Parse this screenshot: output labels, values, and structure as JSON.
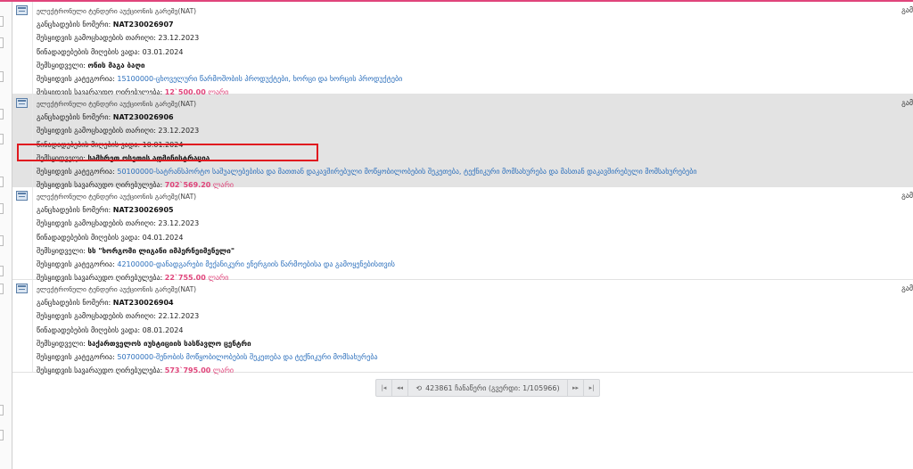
{
  "colors": {
    "accent": "#e0457b",
    "link": "#2a6ebb",
    "highlight_box": "#e0191f",
    "selected_row": "#e3e3e3"
  },
  "records": [
    {
      "type": "ელექტრონული ტენდერი აუქციონის გარეშე(NAT)",
      "number_label": "განცხადების ნომერი:",
      "number": "NAT230026907",
      "published_label": "შესყიდვის გამოცხადების თარიღი:",
      "published": "23.12.2023",
      "deadline_label": "წინადადებების მიღების ვადა:",
      "deadline": "03.01.2024",
      "buyer_label": "შემსყიდველი:",
      "buyer": "ონის მაგა ბაღი",
      "category_label": "შესყიდვის კატეგორია:",
      "category": "15100000-ცხოველური წარმოშობის პროდუქტები, ხორცი და ხორცის პროდუქტები",
      "value_label": "შესყიდვის სავარაუდო ღირებულება:",
      "value": "12`500.00",
      "currency": "ლარი",
      "edge": "გამ"
    },
    {
      "type": "ელექტრონული ტენდერი აუქციონის გარეშე(NAT)",
      "number_label": "განცხადების ნომერი:",
      "number": "NAT230026906",
      "published_label": "შესყიდვის გამოცხადების თარიღი:",
      "published": "23.12.2023",
      "deadline_label": "წინადადებების მიღების ვადა:",
      "deadline": "10.01.2024",
      "buyer_label": "შემსყიდველი:",
      "buyer": "სამხრეთ ოსეთის ადმინისტრაცია",
      "category_label": "შესყიდვის კატეგორია:",
      "category": "50100000-სატრანსპორტო საშუალებებისა და მათთან დაკავშირებული მოწყობილობების შეკეთება, ტექნიკური მომსახურება და მასთან დაკავშირებული მომსახურებები",
      "value_label": "შესყიდვის სავარაუდო ღირებულება:",
      "value": "702`569.20",
      "currency": "ლარი",
      "edge": "გამ"
    },
    {
      "type": "ელექტრონული ტენდერი აუქციონის გარეშე(NAT)",
      "number_label": "განცხადების ნომერი:",
      "number": "NAT230026905",
      "published_label": "შესყიდვის გამოცხადების თარიღი:",
      "published": "23.12.2023",
      "deadline_label": "წინადადებების მიღების ვადა:",
      "deadline": "04.01.2024",
      "buyer_label": "შემსყიდველი:",
      "buyer": "სს \"ხორგომი ლიგანი იმპერნეიმენელი\"",
      "category_label": "შესყიდვის კატეგორია:",
      "category": "42100000-დანადგარები მექანიკური ენერგიის წარმოებისა და გამოყენებისთვის",
      "value_label": "შესყიდვის სავარაუდო ღირებულება:",
      "value": "22`755.00",
      "currency": "ლარი",
      "edge": "გამ"
    },
    {
      "type": "ელექტრონული ტენდერი აუქციონის გარეშე(NAT)",
      "number_label": "განცხადების ნომერი:",
      "number": "NAT230026904",
      "published_label": "შესყიდვის გამოცხადების თარიღი:",
      "published": "22.12.2023",
      "deadline_label": "წინადადებების მიღების ვადა:",
      "deadline": "08.01.2024",
      "buyer_label": "შემსყიდველი:",
      "buyer": "საქართველოს იუსტიციის სასწავლო ცენტრი",
      "category_label": "შესყიდვის კატეგორია:",
      "category": "50700000-შენობის მოწყობილობების შეკეთება და ტექნიკური მომსახურება",
      "value_label": "შესყიდვის სავარაუდო ღირებულება:",
      "value": "573`795.00",
      "currency": "ლარი",
      "edge": "გამ"
    }
  ],
  "pager": {
    "first": "|◂",
    "prev": "◂◂",
    "refresh_icon": "⟲",
    "info": "423861 ჩანაწერი (გვერდი: 1/105966)",
    "next": "▸▸",
    "last": "▸|"
  }
}
